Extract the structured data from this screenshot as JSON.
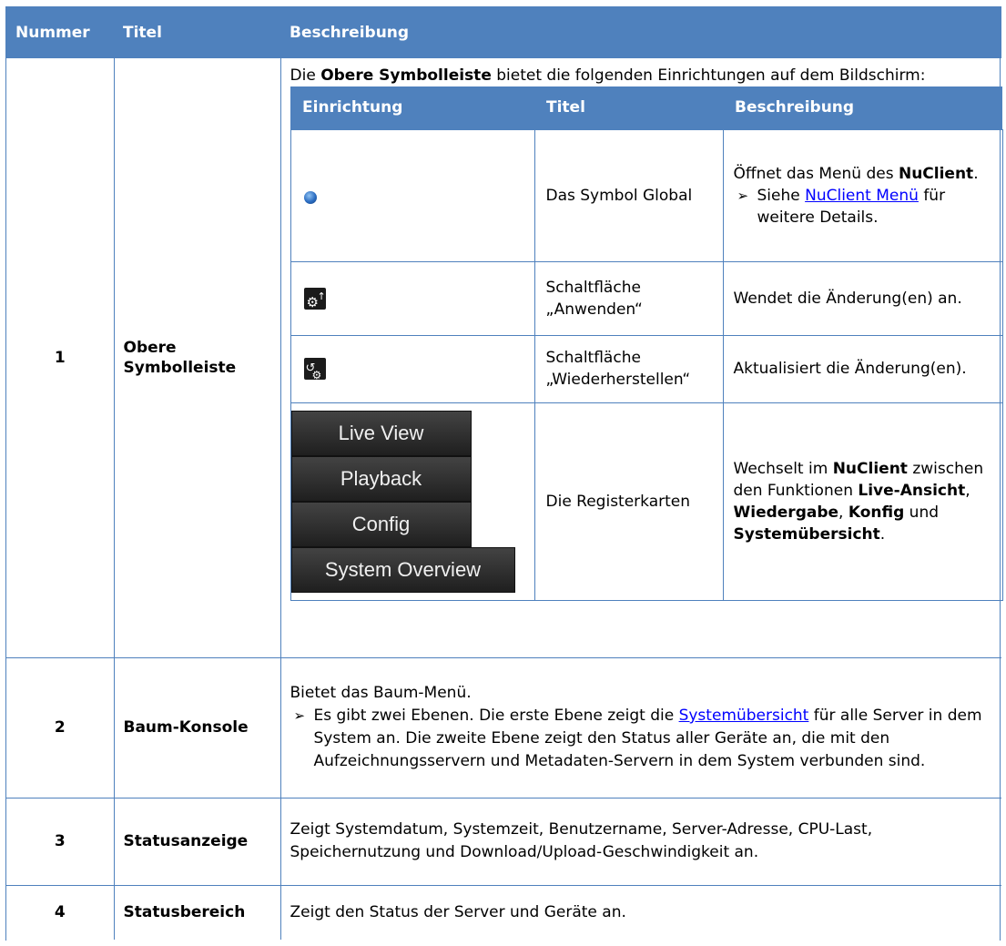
{
  "header": {
    "col_number": "Nummer",
    "col_title": "Titel",
    "col_description": "Beschreibung"
  },
  "rows": [
    {
      "number": "1",
      "title": "Obere Symbolleiste",
      "intro_prefix": "Die ",
      "intro_bold": "Obere Symbolleiste",
      "intro_suffix": " bietet die folgenden Einrichtungen auf dem Bildschirm:",
      "inner": {
        "header": {
          "facility": "Einrichtung",
          "title": "Titel",
          "description": "Beschreibung"
        },
        "rows": [
          {
            "icon": "globe-icon",
            "title": "Das Symbol Global",
            "desc_prefix": "Öffnet das Menü des ",
            "desc_bold": "NuClient",
            "desc_suffix": ".",
            "bullet_prefix": "Siehe ",
            "bullet_link": "NuClient Menü",
            "bullet_suffix": " für weitere Details."
          },
          {
            "icon": "apply-settings-icon",
            "title": "Schaltfläche „Anwenden“",
            "desc": "Wendet die Änderung(en) an."
          },
          {
            "icon": "restore-settings-icon",
            "title": "Schaltfläche „Wiederherstellen“",
            "desc": "Aktualisiert die Änderung(en)."
          },
          {
            "icon": "tab-buttons",
            "tabs": [
              "Live View",
              "Playback",
              "Config",
              "System Overview"
            ],
            "title": "Die Registerkarten",
            "desc_1": "Wechselt im ",
            "desc_b1": "NuClient",
            "desc_2": " zwischen den Funktionen ",
            "desc_b2": "Live-Ansicht",
            "desc_3": ", ",
            "desc_b3": "Wiedergabe",
            "desc_4": ", ",
            "desc_b4": "Konfig",
            "desc_5": " und ",
            "desc_b5": "Systemübersicht",
            "desc_6": "."
          }
        ]
      }
    },
    {
      "number": "2",
      "title": "Baum-Konsole",
      "desc": "Bietet das Baum-Menü.",
      "bullet_prefix": "Es gibt zwei Ebenen. Die erste Ebene zeigt die ",
      "bullet_link": "Systemübersicht",
      "bullet_suffix": " für alle Server in dem System an. Die zweite Ebene zeigt den Status aller Geräte an, die mit den Aufzeichnungsservern und Metadaten-Servern in dem System verbunden sind."
    },
    {
      "number": "3",
      "title": "Statusanzeige",
      "desc": "Zeigt Systemdatum, Systemzeit, Benutzername, Server-Adresse, CPU-Last, Speichernutzung und Download/Upload-Geschwindigkeit an."
    },
    {
      "number": "4",
      "title": "Statusbereich",
      "desc": "Zeigt den Status der Server und Geräte an."
    }
  ],
  "colors": {
    "header_bg": "#4f81bd",
    "header_text": "#ffffff",
    "border": "#4f81bd",
    "link": "#0000ff"
  }
}
